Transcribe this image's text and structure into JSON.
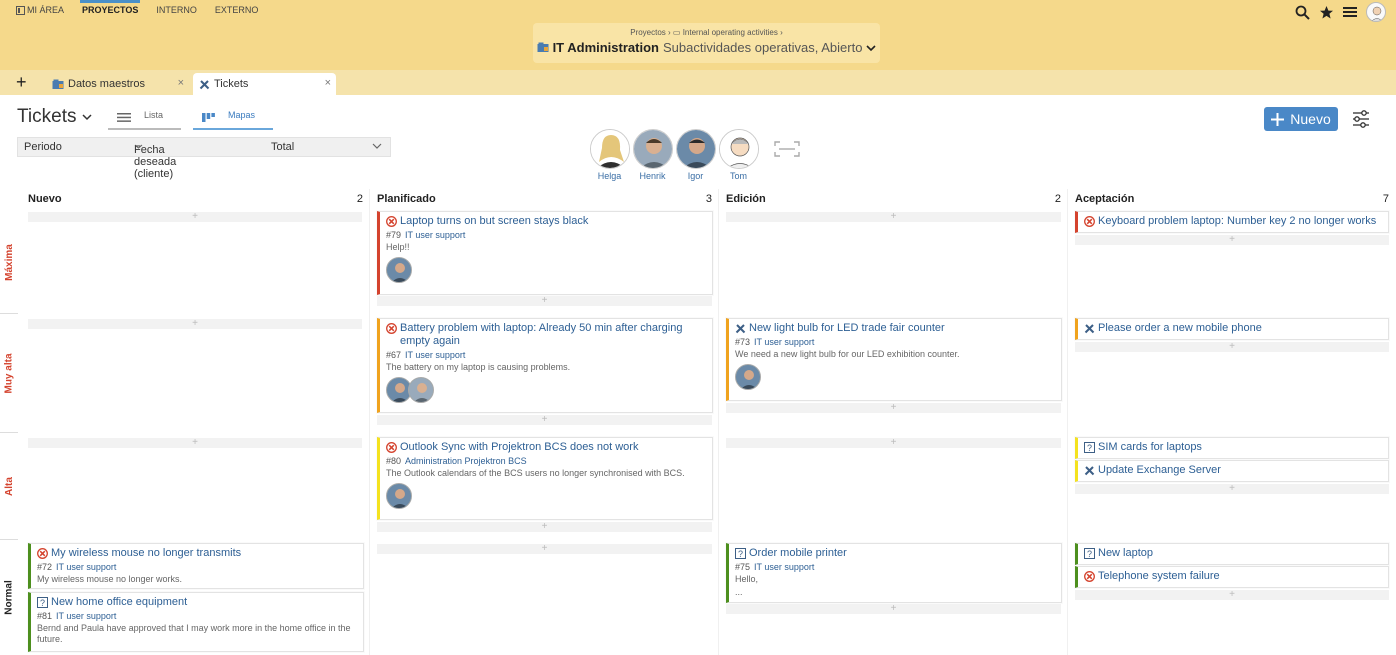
{
  "topnav": {
    "mi_area": "MI ÁREA",
    "proyectos": "PROYECTOS",
    "interno": "INTERNO",
    "externo": "EXTERNO"
  },
  "context": {
    "breadcrumb": "Proyectos  ›  ▭ Internal operating activities  ›",
    "title": "IT Administration",
    "subtitle": "Subactividades operativas, Abierto"
  },
  "tabs": {
    "add": "+",
    "tab1": "Datos maestros",
    "tab2": "Tickets",
    "close": "×"
  },
  "view": {
    "title": "Tickets",
    "lista": "Lista",
    "mapas": "Mapas",
    "new_button": "Nuevo",
    "filters": {
      "periodo": "Periodo",
      "fecha": "Fecha deseada (cliente)",
      "total": "Total"
    }
  },
  "people": [
    "Helga",
    "Henrik",
    "Igor",
    "Tom"
  ],
  "columns": [
    {
      "name": "Nuevo",
      "count": "2"
    },
    {
      "name": "Planificado",
      "count": "3"
    },
    {
      "name": "Edición",
      "count": "2"
    },
    {
      "name": "Aceptación",
      "count": "7"
    }
  ],
  "lanes": [
    "Máxima",
    "Muy alta",
    "Alta",
    "Normal"
  ],
  "add_symbol": "+",
  "cards": {
    "c79": {
      "title": "Laptop turns on but screen stays black",
      "id": "#79",
      "category": "IT user support",
      "desc": "Help!!"
    },
    "c_kb": {
      "title": "Keyboard problem laptop: Number key 2 no longer works"
    },
    "c67": {
      "title": "Battery problem with laptop: Already 50 min after charging empty again",
      "id": "#67",
      "category": "IT user support",
      "desc": "The battery on my laptop is causing problems."
    },
    "c73": {
      "title": "New light bulb for LED trade fair counter",
      "id": "#73",
      "category": "IT user support",
      "desc": "We need a new light bulb for our LED exhibition counter."
    },
    "c_phone": {
      "title": "Please order a new mobile phone"
    },
    "c80": {
      "title": "Outlook Sync with Projektron BCS does not work",
      "id": "#80",
      "category": "Administration Projektron BCS",
      "desc": "The Outlook calendars of the BCS users no longer synchronised with BCS."
    },
    "c_sim": {
      "title": "SIM cards for laptops"
    },
    "c_exch": {
      "title": "Update Exchange Server"
    },
    "c72": {
      "title": "My wireless mouse no longer transmits",
      "id": "#72",
      "category": "IT user support",
      "desc": "My wireless mouse no longer works."
    },
    "c81": {
      "title": "New home office equipment",
      "id": "#81",
      "category": "IT user support",
      "desc": "Bernd and Paula have approved that I may work more in the home office in the future."
    },
    "c75": {
      "title": "Order mobile printer",
      "id": "#75",
      "category": "IT user support",
      "desc": "Hello,",
      "desc2": "..."
    },
    "c_lap": {
      "title": "New laptop"
    },
    "c_tel": {
      "title": "Telephone system failure"
    }
  },
  "colors": {
    "red": "#d4432e",
    "orange": "#f0a31e",
    "yellow": "#f4e21f",
    "green": "#4d8f1e",
    "accent": "#4a88c7",
    "topbar": "#f5d98b"
  }
}
